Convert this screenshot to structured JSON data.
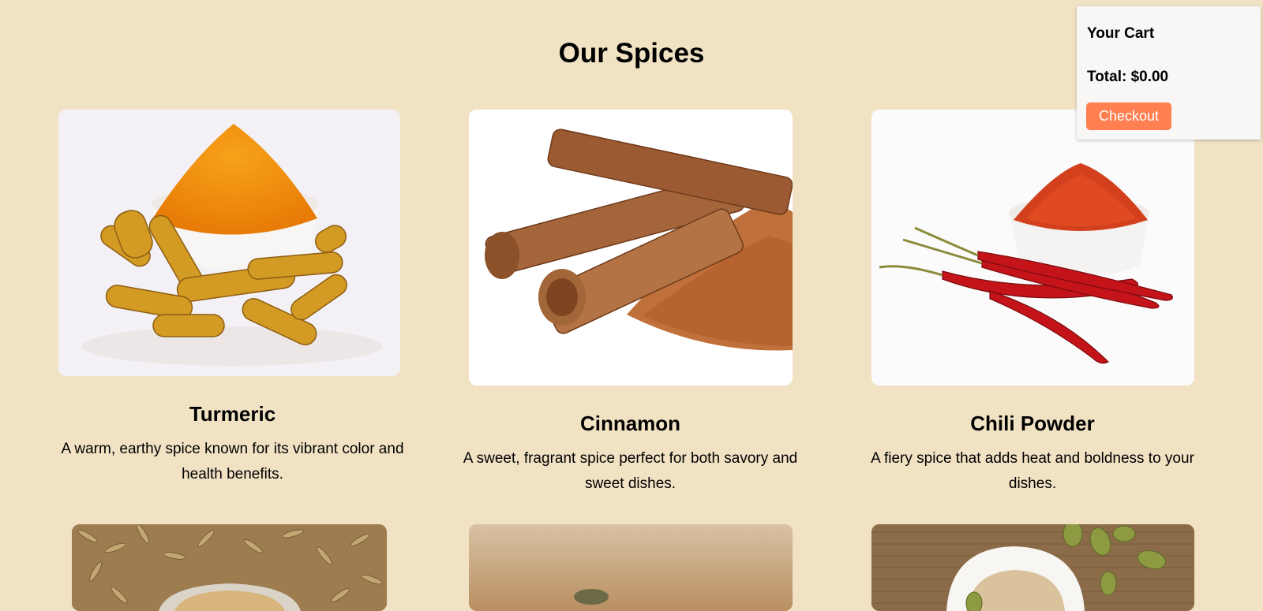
{
  "page": {
    "title": "Our Spices"
  },
  "cart": {
    "title": "Your Cart",
    "total": "Total: $0.00",
    "checkout_label": "Checkout"
  },
  "products": [
    {
      "name": "Turmeric",
      "description": "A warm, earthy spice known for its vibrant color and health benefits."
    },
    {
      "name": "Cinnamon",
      "description": "A sweet, fragrant spice perfect for both savory and sweet dishes."
    },
    {
      "name": "Chili Powder",
      "description": "A fiery spice that adds heat and boldness to your dishes."
    }
  ],
  "colors": {
    "background": "#f1e2c4",
    "checkout": "#ff7f50",
    "cart_bg": "#f8f7f5"
  }
}
